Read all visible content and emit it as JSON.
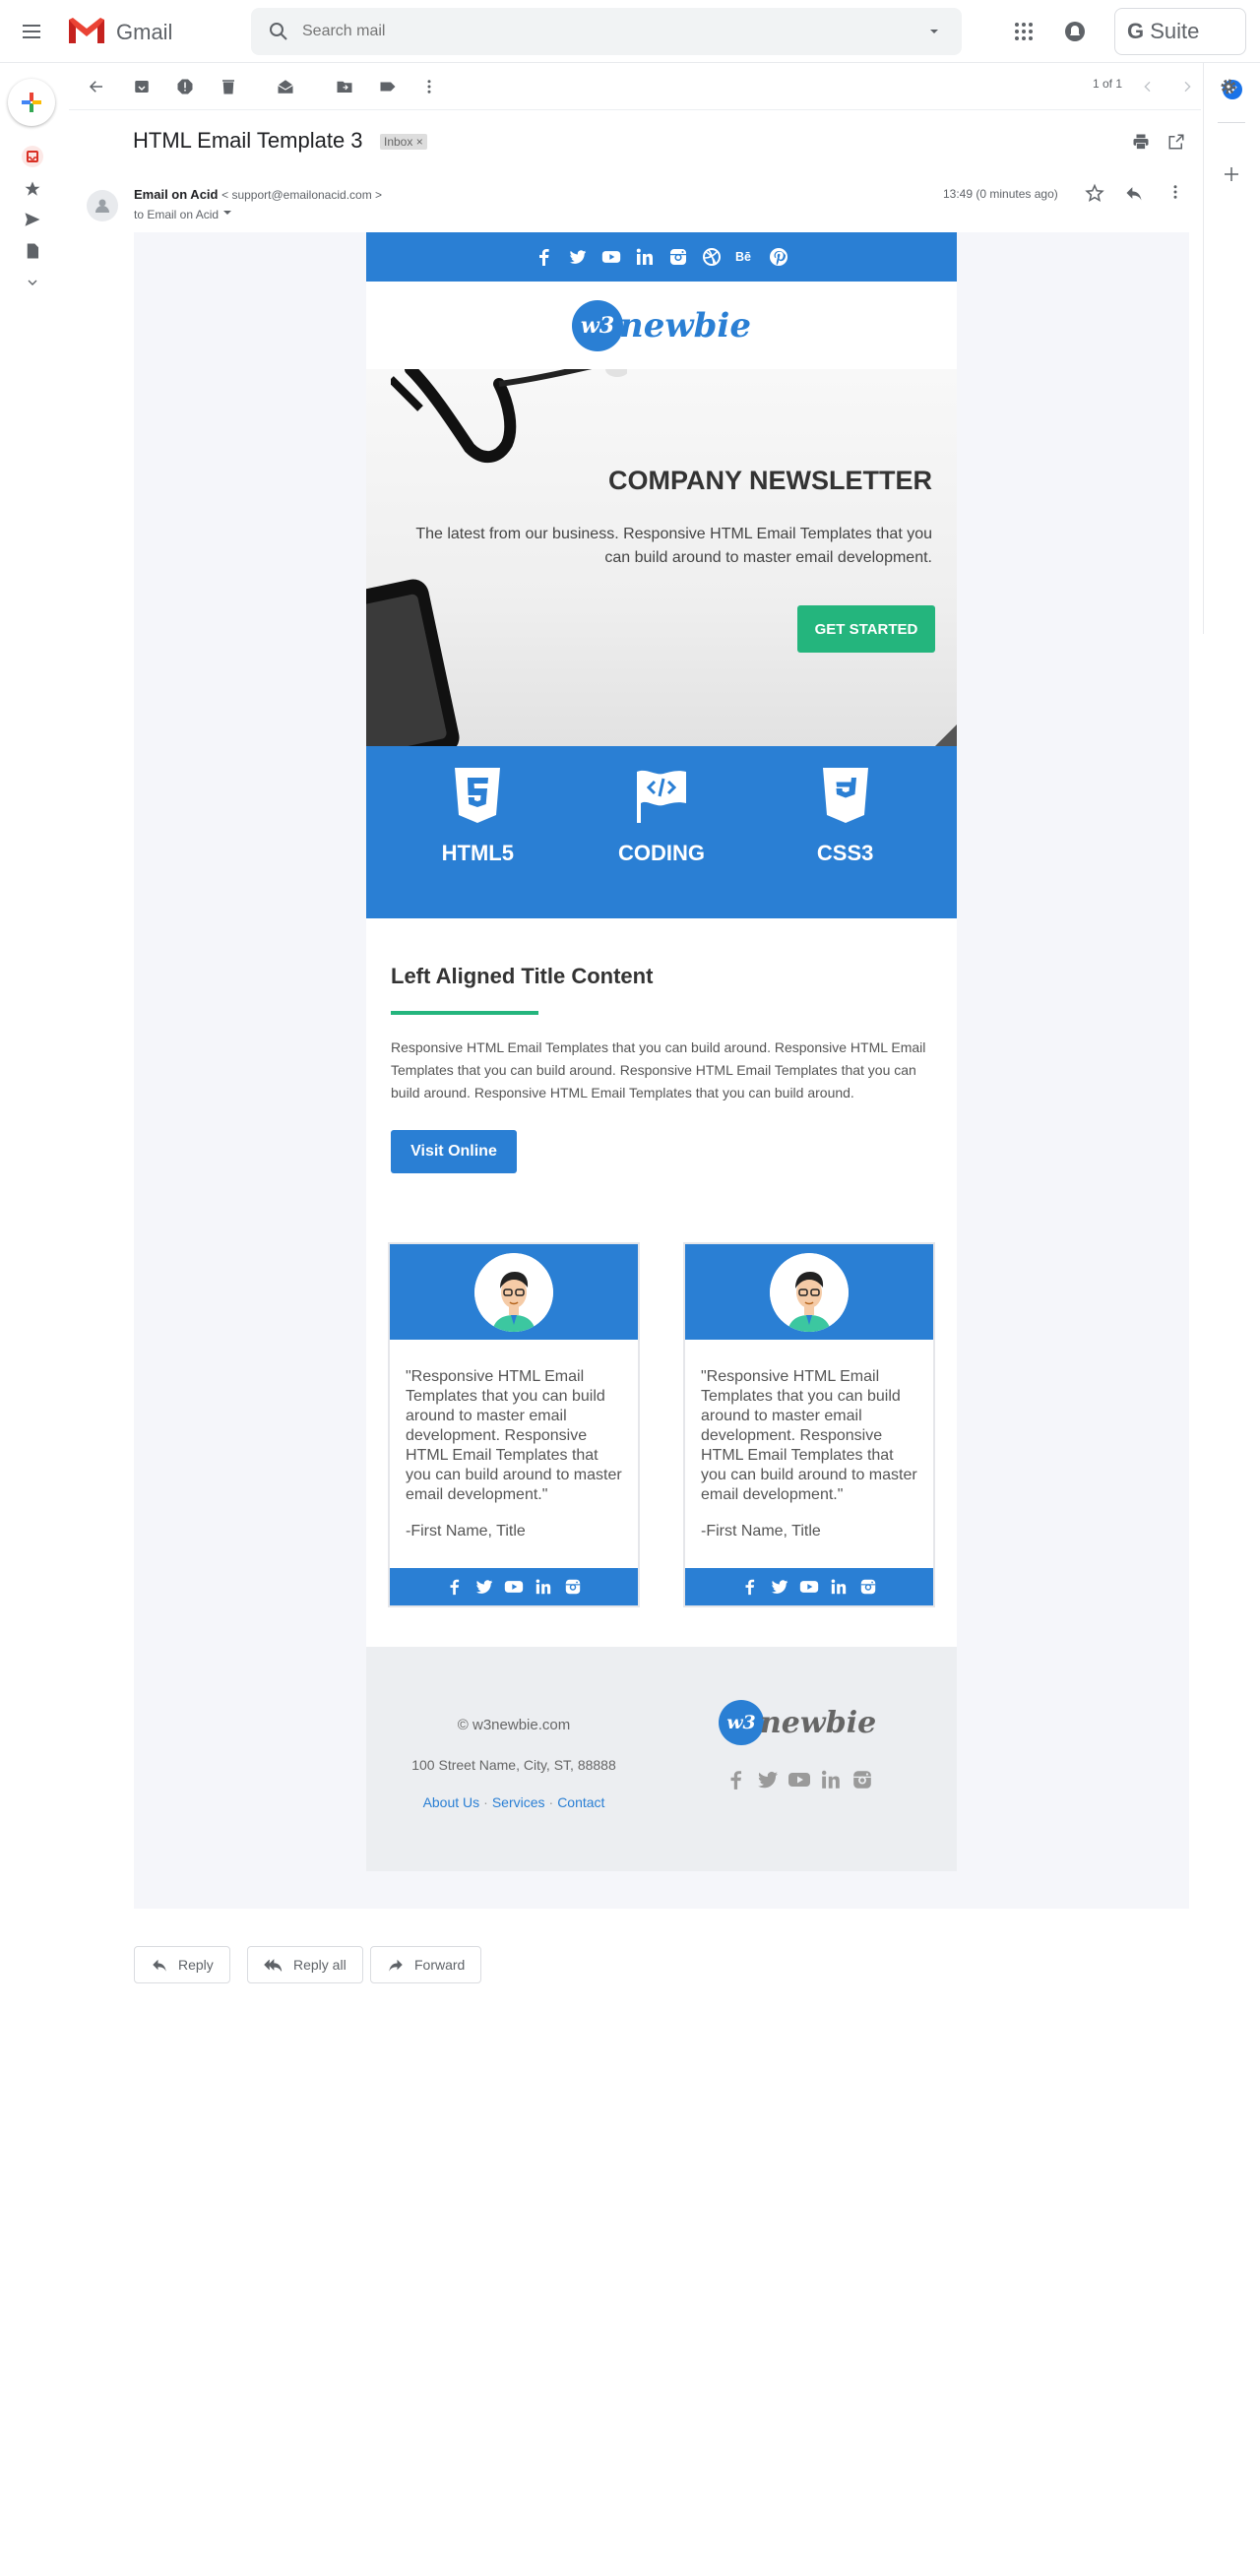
{
  "app": {
    "name": "Gmail",
    "suite_label": "Suite",
    "suite_g": "G"
  },
  "search": {
    "placeholder": "Search mail"
  },
  "toolbar": {
    "pager": "1 of 1"
  },
  "message": {
    "subject": "HTML Email Template 3",
    "label_chip": "Inbox ×",
    "sender_name": "Email on Acid",
    "sender_email": "< support@emailonacid.com >",
    "to_line": "to Email on Acid",
    "time": "13:49 (0 minutes ago)"
  },
  "email": {
    "logo": {
      "mark": "w3",
      "word": "newbie"
    },
    "hero": {
      "title": "COMPANY NEWSLETTER",
      "text": "The latest from our business. Responsive HTML Email Templates that you can build around to master email development.",
      "button": "GET STARTED"
    },
    "features": [
      {
        "label": "HTML5",
        "icon": "html5-icon"
      },
      {
        "label": "CODING",
        "icon": "code-flag-icon"
      },
      {
        "label": "CSS3",
        "icon": "css3-icon"
      }
    ],
    "content": {
      "title": "Left Aligned Title Content",
      "body": "Responsive HTML Email Templates that you can build around. Responsive HTML Email Templates that you can build around. Responsive HTML Email Templates that you can build around. Responsive HTML Email Templates that you can build around.",
      "button": "Visit Online"
    },
    "testimonials": [
      {
        "quote": "\"Responsive HTML Email Templates that you can build around to master email development. Responsive HTML Email Templates that you can build around to master email development.\"",
        "name": "-First Name, Title"
      },
      {
        "quote": "\"Responsive HTML Email Templates that you can build around to master email development. Responsive HTML Email Templates that you can build around to master email development.\"",
        "name": "-First Name, Title"
      }
    ],
    "footer": {
      "copyright": "© w3newbie.com",
      "address": "100 Street Name, City, ST, 88888",
      "links": [
        "About Us",
        "Services",
        "Contact"
      ]
    }
  },
  "actions": {
    "reply": "Reply",
    "reply_all": "Reply all",
    "forward": "Forward"
  },
  "colors": {
    "brand_blue": "#2a7fd4",
    "accent_green": "#24b57d",
    "footer_bg": "#eceef1"
  }
}
